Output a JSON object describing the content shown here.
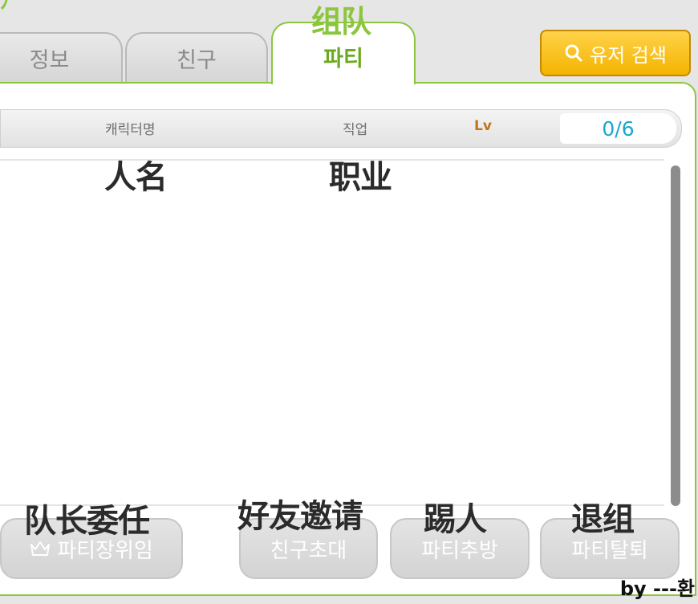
{
  "tabs": [
    {
      "label": "정보"
    },
    {
      "label": "친구"
    },
    {
      "label": "파티",
      "annotation": "组队"
    }
  ],
  "search_button": {
    "label": "유저 검색",
    "icon": "search-icon"
  },
  "table_header": {
    "name_label": "캐릭터명",
    "job_label": "직업",
    "level_label": "Lv",
    "count": "0/6"
  },
  "annotations": {
    "name": "人名",
    "job": "职业",
    "leader": "队长委任",
    "invite": "好友邀请",
    "kick": "踢人",
    "leave": "退组"
  },
  "buttons": {
    "delegate_leader": "파티장위임",
    "invite_friend": "친구초대",
    "kick_member": "파티추방",
    "leave_party": "파티탈퇴"
  },
  "credit": "by ---환",
  "colors": {
    "accent_green": "#8cc63f",
    "search_yellow": "#f4b400",
    "count_blue": "#1aa7d0",
    "level_orange": "#c0741c"
  }
}
